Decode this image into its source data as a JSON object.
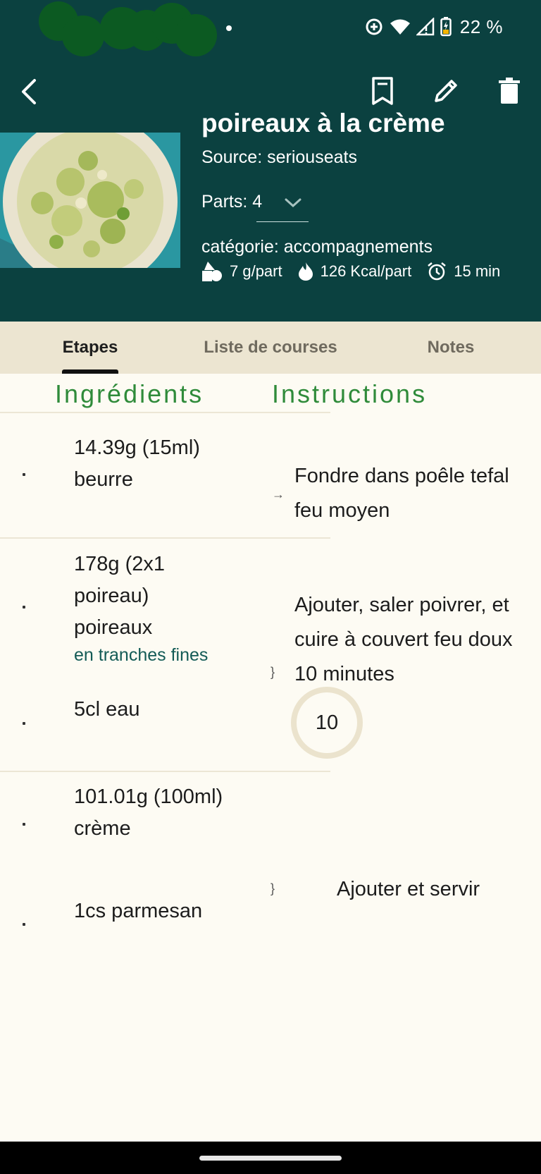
{
  "status_bar": {
    "battery_text": "22 %",
    "icons": [
      "data-saver-icon",
      "wifi-icon",
      "cellular-icon",
      "battery-charging-icon"
    ]
  },
  "toolbar": {
    "back_icon": "arrow-back-icon",
    "bookmark_icon": "bookmark-icon",
    "edit_icon": "pencil-icon",
    "delete_icon": "trash-icon"
  },
  "recipe": {
    "title": "poireaux à la crème",
    "source": "Source: seriouseats",
    "parts_label": "Parts: 4",
    "category": "catégorie: accompagnements",
    "nutrition": {
      "per_part_weight": "7 g/part",
      "calories": "126 Kcal/part",
      "duration": "15 min"
    }
  },
  "tabs": [
    {
      "label": "Etapes",
      "active": true
    },
    {
      "label": "Liste de courses",
      "active": false
    },
    {
      "label": "Notes",
      "active": false
    }
  ],
  "columns": {
    "ingredients": "Ingrédients",
    "instructions": "Instructions"
  },
  "steps": [
    {
      "ingredients": [
        {
          "line1": "14.39g (15ml)",
          "line2": "beurre"
        }
      ],
      "connector": "→",
      "instruction": [
        "Fondre dans poêle tefal",
        "feu moyen"
      ]
    },
    {
      "ingredients": [
        {
          "line1": "178g (2x1",
          "line2": "poireau)",
          "line3": "poireaux",
          "note": "en tranches fines"
        },
        {
          "line1": "5cl eau"
        }
      ],
      "connector": "}",
      "instruction": [
        "Ajouter, saler poivrer, et",
        "cuire à couvert feu doux",
        "10 minutes"
      ],
      "timer": "10"
    },
    {
      "ingredients": [
        {
          "line1": "101.01g (100ml)",
          "line2": "crème"
        },
        {
          "line1": "1cs parmesan"
        }
      ],
      "connector": "}",
      "instruction": [
        "Ajouter et servir"
      ]
    }
  ],
  "colors": {
    "header_bg": "#0b4140",
    "accent_green": "#2f8b3a",
    "tabs_bg": "#ece5d1",
    "page_bg": "#fdfbf3"
  }
}
